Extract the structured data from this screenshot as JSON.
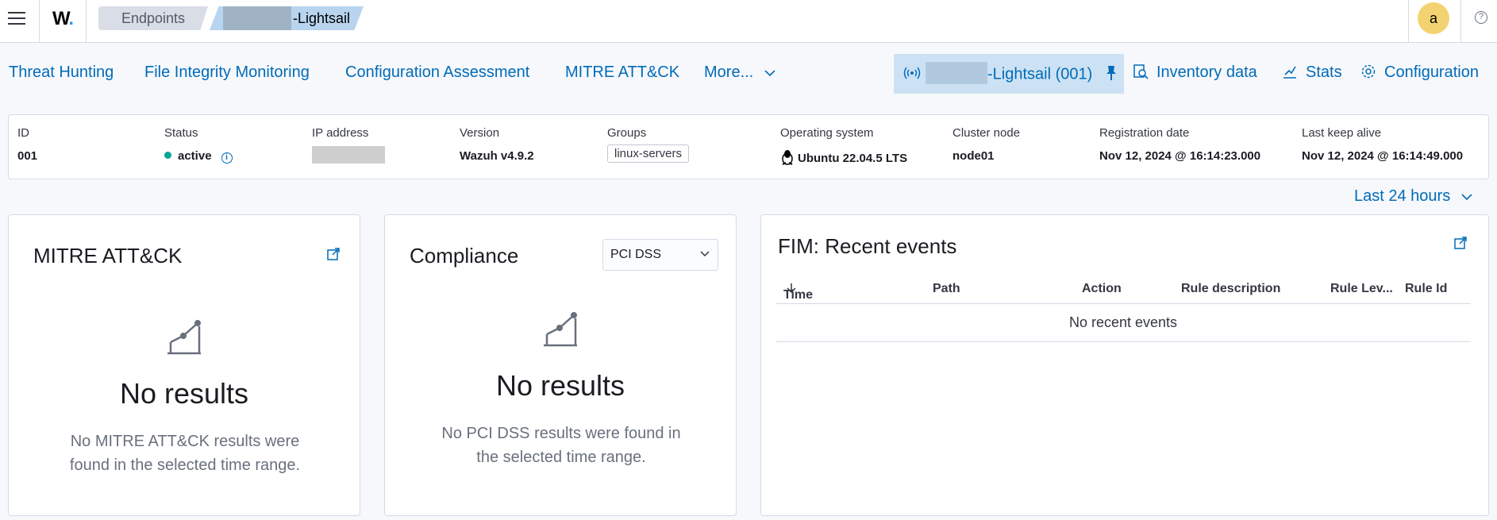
{
  "header": {
    "logo": "W",
    "breadcrumbs": [
      "Endpoints",
      "-Lightsail"
    ],
    "avatar_initial": "a"
  },
  "nav": {
    "tabs": [
      "Threat Hunting",
      "File Integrity Monitoring",
      "Configuration Assessment",
      "MITRE ATT&CK",
      "More..."
    ],
    "pinned_agent": "-Lightsail (001)",
    "inventory": "Inventory data",
    "stats": "Stats",
    "configuration": "Configuration"
  },
  "agent": {
    "fields": {
      "id": {
        "label": "ID",
        "value": "001"
      },
      "status": {
        "label": "Status",
        "value": "active"
      },
      "ip": {
        "label": "IP address",
        "value": ""
      },
      "version": {
        "label": "Version",
        "value": "Wazuh v4.9.2"
      },
      "groups": {
        "label": "Groups",
        "value": "linux-servers"
      },
      "os": {
        "label": "Operating system",
        "value": "Ubuntu 22.04.5 LTS"
      },
      "cluster": {
        "label": "Cluster node",
        "value": "node01"
      },
      "registration": {
        "label": "Registration date",
        "value": "Nov 12, 2024 @ 16:14:23.000"
      },
      "keepalive": {
        "label": "Last keep alive",
        "value": "Nov 12, 2024 @ 16:14:49.000"
      }
    }
  },
  "time_filter": "Last 24 hours",
  "panels": {
    "mitre": {
      "title": "MITRE ATT&CK",
      "empty_title": "No results",
      "empty_body": "No MITRE ATT&CK results were found in the selected time range."
    },
    "compliance": {
      "title": "Compliance",
      "selected": "PCI DSS",
      "empty_title": "No results",
      "empty_body": "No PCI DSS results were found in the selected time range."
    },
    "fim": {
      "title": "FIM: Recent events",
      "columns": [
        "Time",
        "Path",
        "Action",
        "Rule description",
        "Rule Lev...",
        "Rule Id"
      ],
      "empty": "No recent events"
    }
  },
  "colors": {
    "accent": "#006bb8",
    "status_active": "#00a69b",
    "avatar": "#f3d371"
  }
}
